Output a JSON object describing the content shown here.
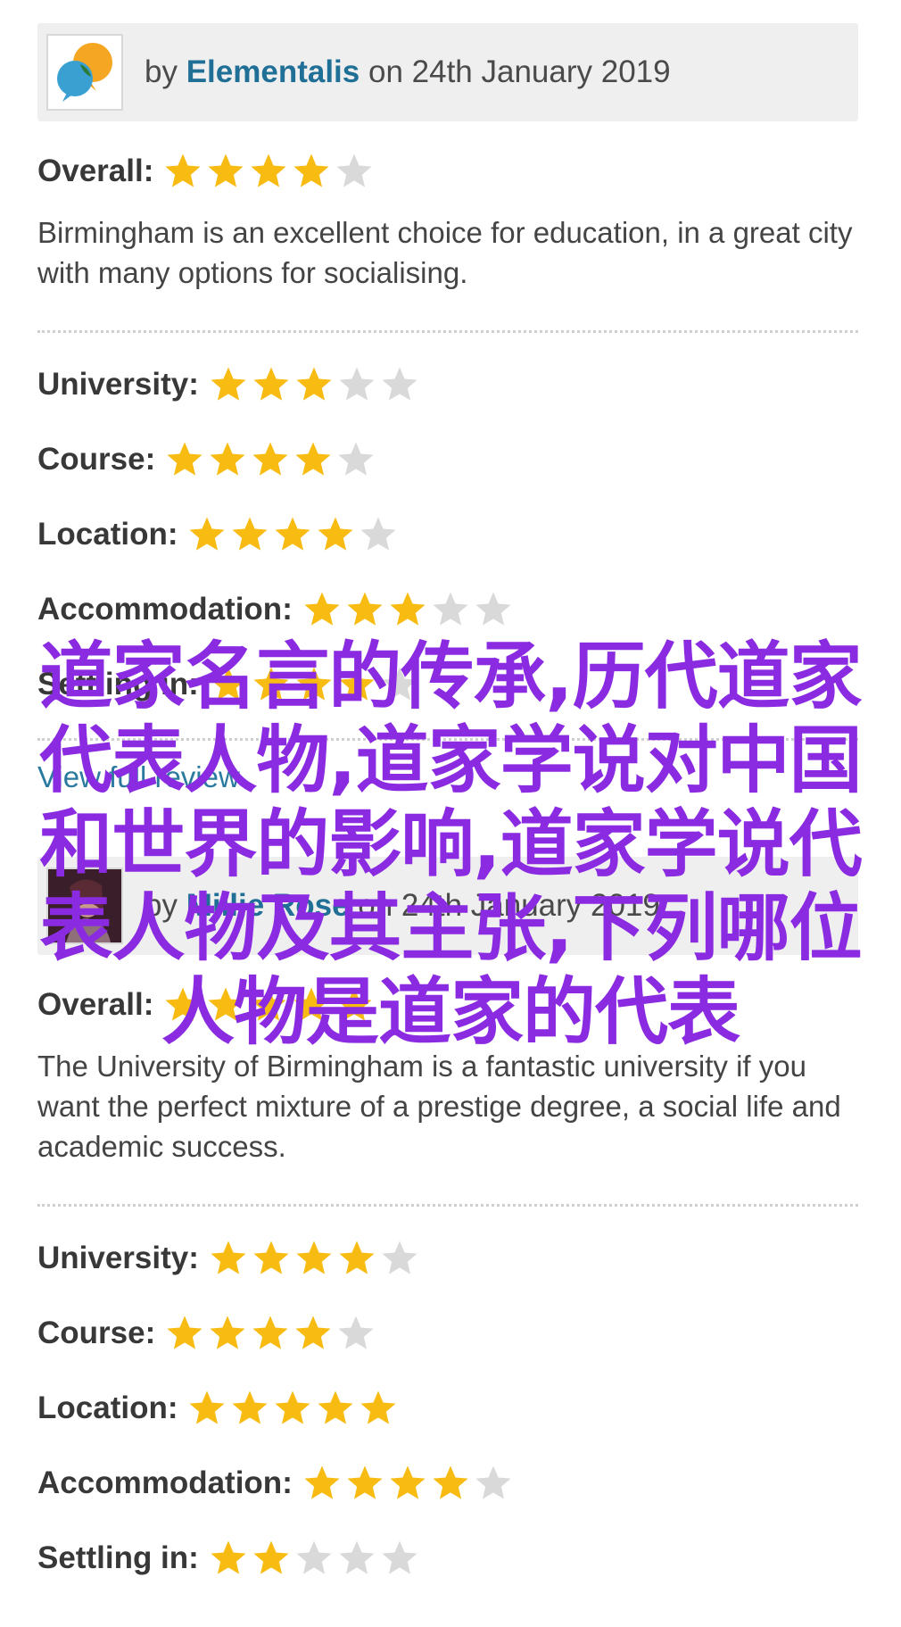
{
  "reviews": [
    {
      "by": "by",
      "author": "Elementalis",
      "date_text": "on 24th January 2019",
      "avatar_icon": "speech-bubbles-logo-icon",
      "overall_label": "Overall:",
      "overall_stars": 4,
      "text": "Birmingham is an excellent choice for education, in a great city with many options for socialising.",
      "ratings": [
        {
          "label": "University:",
          "stars": 3
        },
        {
          "label": "Course:",
          "stars": 4
        },
        {
          "label": "Location:",
          "stars": 4
        },
        {
          "label": "Accommodation:",
          "stars": 3
        },
        {
          "label": "Settling in:",
          "stars": 4
        }
      ],
      "link": "View full review"
    },
    {
      "by": "by",
      "author": "Millie Rose",
      "date_text": "on 24th January 2019",
      "avatar_icon": "user-photo-avatar-icon",
      "overall_label": "Overall:",
      "overall_stars": 5,
      "text": "The University of Birmingham is a fantastic university if you want the perfect mixture of a prestige degree, a social life and academic success.",
      "ratings": [
        {
          "label": "University:",
          "stars": 4
        },
        {
          "label": "Course:",
          "stars": 4
        },
        {
          "label": "Location:",
          "stars": 5
        },
        {
          "label": "Accommodation:",
          "stars": 4
        },
        {
          "label": "Settling in:",
          "stars": 2
        }
      ]
    }
  ],
  "max_stars": 5,
  "colors": {
    "star_on": "#f7bb12",
    "star_off": "#d9d9d9",
    "author": "#1f6f96",
    "watermark": "#8a2be2"
  },
  "watermark": {
    "lines": [
      "道家名言的传承,历代道家",
      "代表人物,道家学说对中国",
      "和世界的影响,道家学说代",
      "表人物及其主张,下列哪位",
      "人物是道家的代表"
    ]
  }
}
